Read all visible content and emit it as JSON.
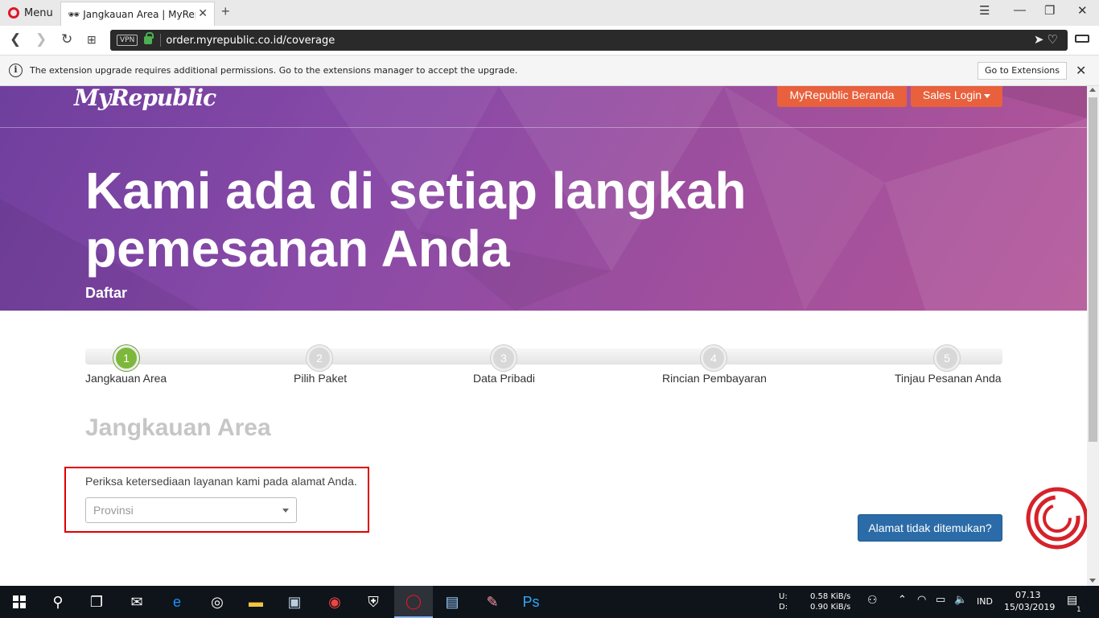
{
  "browser": {
    "menu_label": "Menu",
    "tab_title": "Jangkauan Area | MyRepubl",
    "vpn_label": "VPN",
    "url": "order.myrepublic.co.id/coverage"
  },
  "notification": {
    "text": "The extension upgrade requires additional permissions. Go to the extensions manager to accept the upgrade.",
    "button_label": "Go to Extensions"
  },
  "header": {
    "logo_text": "MyRepublic",
    "nav_home": "MyRepublic Beranda",
    "nav_sales": "Sales Login"
  },
  "hero": {
    "title": "Kami ada di setiap langkah pemesanan Anda",
    "subtitle": "Daftar"
  },
  "steps": [
    {
      "number": "1",
      "label": "Jangkauan Area",
      "active": true
    },
    {
      "number": "2",
      "label": "Pilih Paket",
      "active": false
    },
    {
      "number": "3",
      "label": "Data Pribadi",
      "active": false
    },
    {
      "number": "4",
      "label": "Rincian Pembayaran",
      "active": false
    },
    {
      "number": "5",
      "label": "Tinjau Pesanan Anda",
      "active": false
    }
  ],
  "coverage": {
    "section_title": "Jangkauan Area",
    "instruction": "Periksa ketersediaan layanan kami pada alamat Anda.",
    "province_placeholder": "Provinsi",
    "not_found_button": "Alamat tidak ditemukan?"
  },
  "taskbar": {
    "net_upload_label": "U:",
    "net_download_label": "D:",
    "net_upload": "0.58 KiB/s",
    "net_download": "0.90 KiB/s",
    "language": "IND",
    "time": "07.13",
    "date": "15/03/2019",
    "notification_count": "1"
  },
  "colors": {
    "accent_orange": "#e8603c",
    "step_active": "#7cb83a",
    "button_blue": "#2b6ca8",
    "highlight_red": "#e00000",
    "hero_purple": "#8a4aa8"
  }
}
